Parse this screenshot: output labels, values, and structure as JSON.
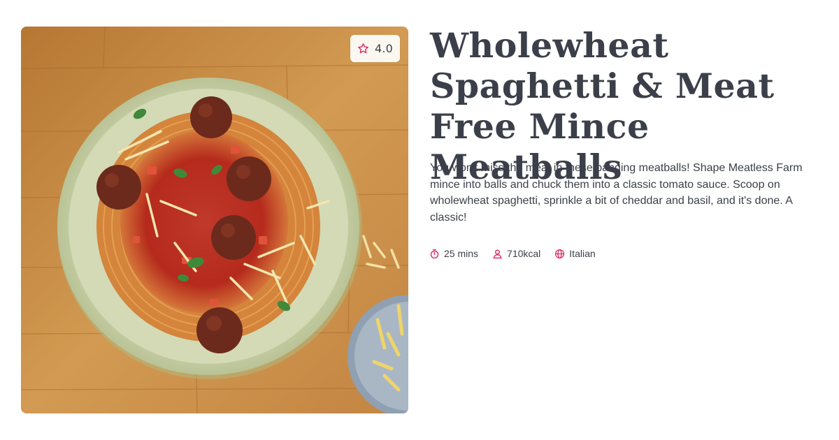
{
  "recipe": {
    "title": "Wholewheat Spaghetti & Meat Free Mince Meatballs",
    "description": "You won't miss the meat in these banging meatballs! Shape Meatless Farm mince into balls and chuck them into a classic tomato sauce. Scoop on wholewheat spaghetti, sprinkle a bit of cheddar and basil, and it's done. A classic!",
    "rating": "4.0",
    "meta": {
      "time": "25 mins",
      "calories": "710kcal",
      "cuisine": "Italian"
    }
  },
  "icons": {
    "rating": "star-icon",
    "time": "stopwatch-icon",
    "calories": "person-icon",
    "cuisine": "globe-icon"
  },
  "colors": {
    "accent": "#e0245e",
    "text": "#3b3f49",
    "badge_bg": "#fbf7f1",
    "wood": "#c8893f",
    "bowl": "#c9d2a8"
  }
}
